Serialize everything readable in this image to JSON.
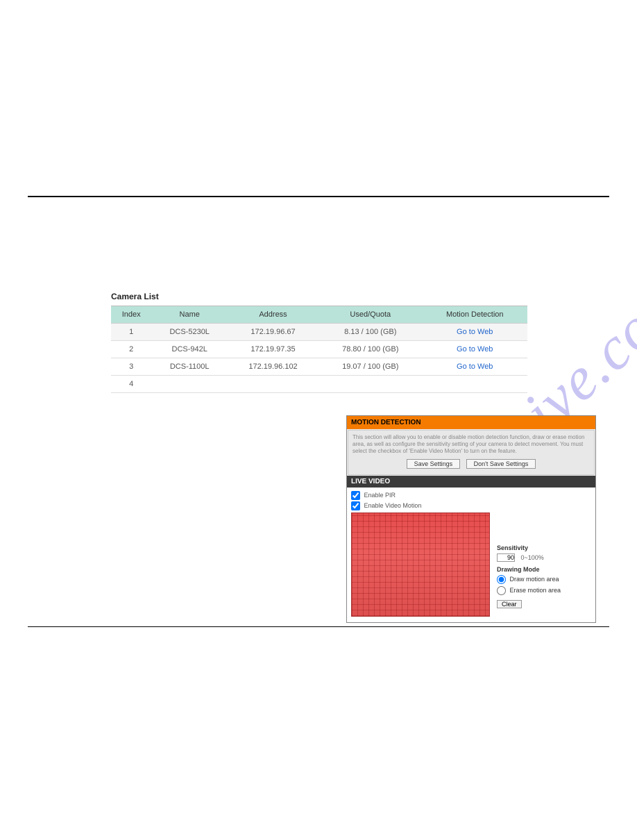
{
  "watermark": "manualshive.com",
  "cameraList": {
    "title": "Camera List",
    "headers": {
      "index": "Index",
      "name": "Name",
      "address": "Address",
      "usedQuota": "Used/Quota",
      "motion": "Motion Detection"
    },
    "rows": [
      {
        "index": "1",
        "name": "DCS-5230L",
        "address": "172.19.96.67",
        "usedQuota": "8.13 / 100 (GB)",
        "motion": "Go to Web"
      },
      {
        "index": "2",
        "name": "DCS-942L",
        "address": "172.19.97.35",
        "usedQuota": "78.80 / 100 (GB)",
        "motion": "Go to Web"
      },
      {
        "index": "3",
        "name": "DCS-1100L",
        "address": "172.19.96.102",
        "usedQuota": "19.07 / 100 (GB)",
        "motion": "Go to Web"
      },
      {
        "index": "4",
        "name": "",
        "address": "",
        "usedQuota": "",
        "motion": ""
      }
    ]
  },
  "motion": {
    "header": "MOTION DETECTION",
    "description": "This section will allow you to enable or disable motion detection function, draw or erase motion area, as well as configure the sensitivity setting of your camera to detect movement. You must select the checkbox of 'Enable Video Motion' to turn on the feature.",
    "saveLabel": "Save Settings",
    "dontSaveLabel": "Don't Save Settings",
    "liveHeader": "LIVE VIDEO",
    "enablePirLabel": "Enable PIR",
    "enableVideoMotionLabel": "Enable Video Motion",
    "sensitivityLabel": "Sensitivity",
    "sensitivityValue": "90",
    "sensitivityRange": "0~100%",
    "drawingModeLabel": "Drawing Mode",
    "drawAreaLabel": "Draw motion area",
    "eraseAreaLabel": "Erase motion area",
    "clearLabel": "Clear"
  }
}
